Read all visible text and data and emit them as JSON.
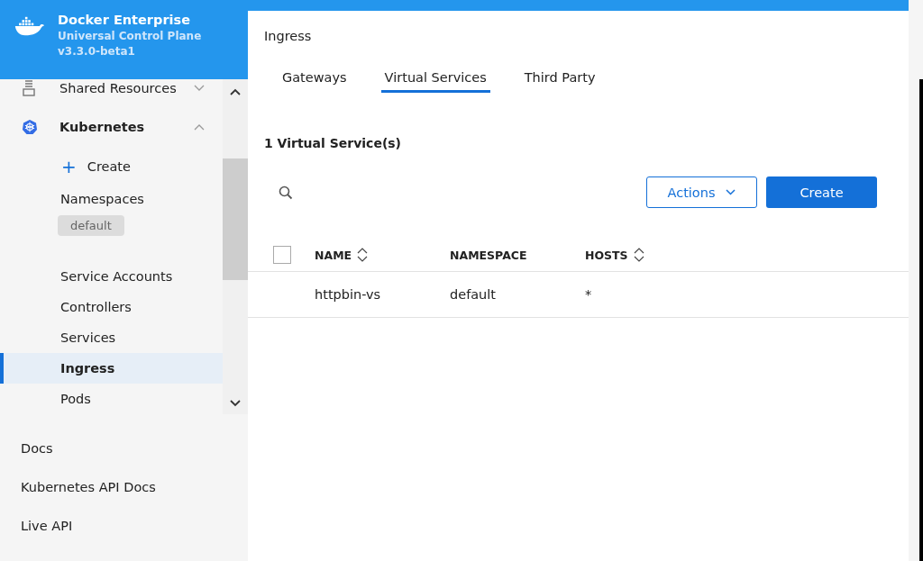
{
  "brand": {
    "title": "Docker Enterprise",
    "subtitle": "Universal Control Plane",
    "version": "v3.3.0-beta1"
  },
  "sidebar": {
    "sections": [
      {
        "label": "Shared Resources",
        "kind": "resources",
        "expanded": false,
        "selected": false
      },
      {
        "label": "Kubernetes",
        "kind": "kubernetes",
        "expanded": true,
        "selected": true
      }
    ],
    "create": {
      "icon": "+",
      "label": "Create"
    },
    "namespaces": {
      "label": "Namespaces",
      "current": "default"
    },
    "items": [
      {
        "label": "Service Accounts",
        "selected": false
      },
      {
        "label": "Controllers",
        "selected": false
      },
      {
        "label": "Services",
        "selected": false
      },
      {
        "label": "Ingress",
        "selected": true
      },
      {
        "label": "Pods",
        "selected": false
      }
    ],
    "links": [
      "Docs",
      "Kubernetes API Docs",
      "Live API"
    ]
  },
  "page": {
    "title": "Ingress",
    "tabs": [
      {
        "label": "Gateways",
        "selected": false
      },
      {
        "label": "Virtual Services",
        "selected": true
      },
      {
        "label": "Third Party",
        "selected": false
      }
    ],
    "count": "1 Virtual Service(s)",
    "actions_button": "Actions",
    "create_button": "Create",
    "table": {
      "select_all": {
        "checked": false
      },
      "columns": [
        {
          "label": "NAME",
          "sortable": true
        },
        {
          "label": "NAMESPACE",
          "sortable": false
        },
        {
          "label": "HOSTS",
          "sortable": true
        }
      ],
      "rows": [
        {
          "cells": [
            "httpbin-vs",
            "default",
            "*"
          ]
        }
      ]
    }
  }
}
